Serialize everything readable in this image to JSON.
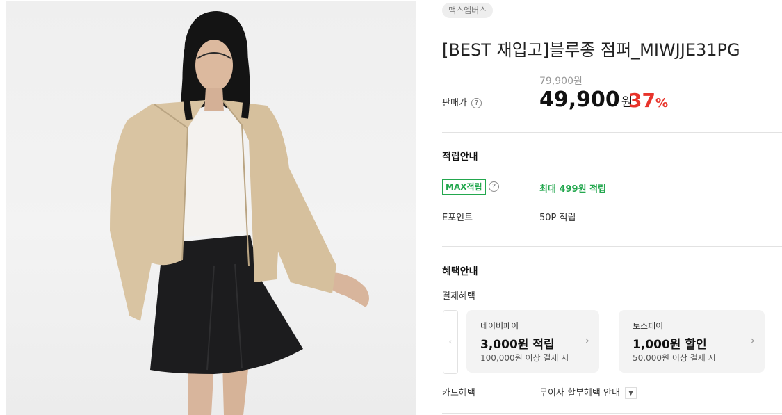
{
  "product": {
    "brand": "맥스엠버스",
    "title": "[BEST 재입고]블루종 점퍼_MIWJJE31PG",
    "price_label": "판매가",
    "original_price": "79,900원",
    "sale_price": "49,900",
    "sale_unit": "원",
    "discount_rate": "37",
    "discount_unit": "%"
  },
  "points": {
    "section_title": "적립안내",
    "max_badge": "MAX적립",
    "max_text": "최대 499원 적립",
    "epoint_label": "E포인트",
    "epoint_value": "50P 적립"
  },
  "benefits": {
    "section_title": "혜택안내",
    "payment_label": "결제혜택",
    "prev_arrow": "‹",
    "cards": [
      {
        "name": "네이버페이",
        "amount": "3,000원 적립",
        "condition": "100,000원 이상 결제 시"
      },
      {
        "name": "토스페이",
        "amount": "1,000원 할인",
        "condition": "50,000원 이상 결제 시"
      }
    ],
    "card_label": "카드혜택",
    "card_value": "무이자 할부혜택 안내"
  },
  "icons": {
    "help": "?",
    "chevron_right": "›",
    "dropdown": "▼"
  },
  "colors": {
    "discount": "#e8342b",
    "green": "#23a74e",
    "jacket": "#d9c4a2",
    "skirt": "#1c1c1e"
  }
}
